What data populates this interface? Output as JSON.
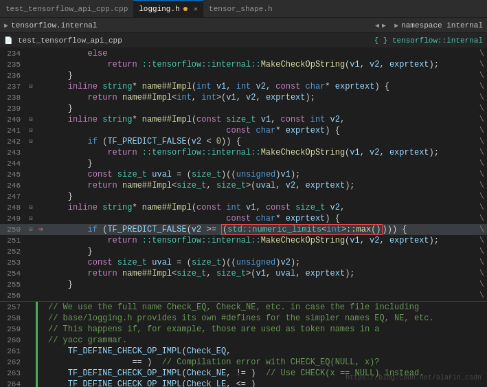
{
  "tabs": [
    {
      "label": "test_tensorflow_api_cpp.cpp",
      "active": false,
      "modified": false
    },
    {
      "label": "logging.h",
      "active": true,
      "modified": true
    },
    {
      "label": "tensor_shape.h",
      "active": false,
      "modified": false
    }
  ],
  "breadcrumb": {
    "namespace": "tensorflow.internal"
  },
  "breadcrumb2": {
    "namespace": "namespace internal"
  },
  "filepath": {
    "file": "test_tensorflow_api_cpp",
    "func": "tensorflow::internal"
  },
  "watermark": "https://blog.csdn.net/alaFin_csdn"
}
